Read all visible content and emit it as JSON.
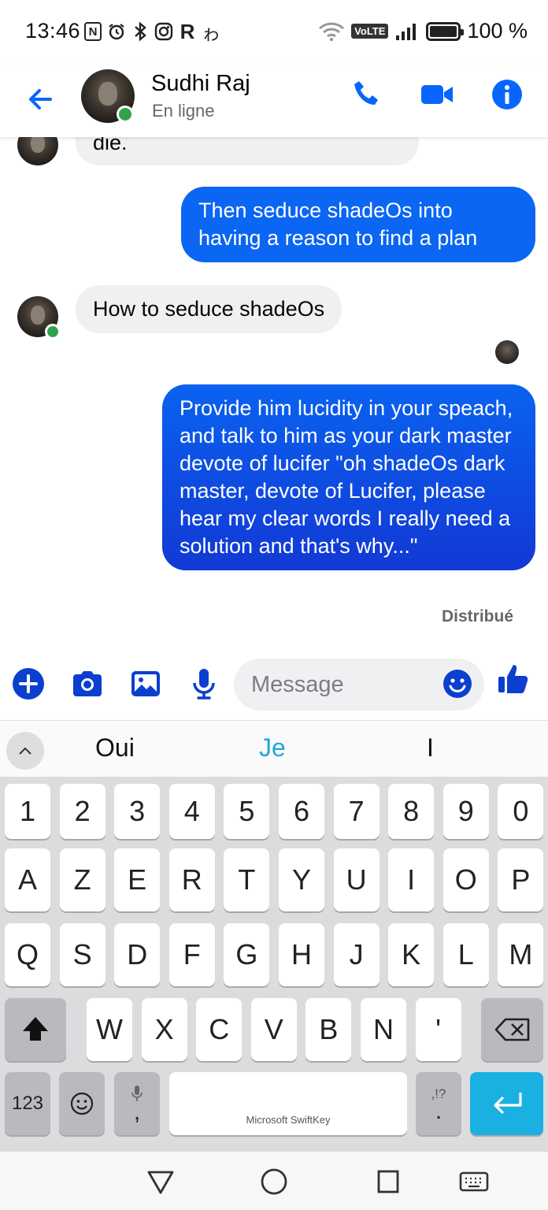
{
  "status_bar": {
    "time": "13:46",
    "left_icons": [
      "nfc-icon",
      "alarm-icon",
      "bluetooth-icon",
      "instagram-icon",
      "r-app-icon",
      "hiragana-app-icon"
    ],
    "left_glyphs": {
      "nfc": "N",
      "r_app": "R",
      "hiragana": "ゎ"
    },
    "volte": "VoLTE",
    "battery": "100 %"
  },
  "header": {
    "contact_name": "Sudhi Raj",
    "contact_status": "En ligne",
    "accent_color": "#0866ff"
  },
  "messages": [
    {
      "direction": "incoming",
      "text": "die."
    },
    {
      "direction": "outgoing",
      "text": "Then seduce shadeOs into having a reason to find a plan"
    },
    {
      "direction": "incoming",
      "text": "How to seduce shadeOs"
    },
    {
      "direction": "outgoing",
      "text": "Provide him lucidity in your speach, and talk to him as your dark master devote of lucifer \"oh shadeOs dark master, devote of Lucifer, please hear my clear words I really need a solution and that's why...\""
    }
  ],
  "delivery_status": "Distribué",
  "composer": {
    "placeholder": "Message",
    "icons": [
      "add-icon",
      "camera-icon",
      "gallery-icon",
      "microphone-icon",
      "emoji-icon",
      "thumbs-up-icon"
    ]
  },
  "keyboard": {
    "suggestions": [
      "Oui",
      "Je",
      "I"
    ],
    "number_row": [
      "1",
      "2",
      "3",
      "4",
      "5",
      "6",
      "7",
      "8",
      "9",
      "0"
    ],
    "row1": [
      "A",
      "Z",
      "E",
      "R",
      "T",
      "Y",
      "U",
      "I",
      "O",
      "P"
    ],
    "row2": [
      "Q",
      "S",
      "D",
      "F",
      "G",
      "H",
      "J",
      "K",
      "L",
      "M"
    ],
    "row3": [
      "W",
      "X",
      "C",
      "V",
      "B",
      "N",
      "'"
    ],
    "numbers_key": "123",
    "comma_key": ",",
    "period_key": ".",
    "punct_hint": ",!?",
    "space_label": "Microsoft SwiftKey",
    "enter_color": "#1ab0e2"
  },
  "nav_bar": {
    "icons": [
      "back-triangle-icon",
      "home-circle-icon",
      "recents-square-icon",
      "keyboard-icon"
    ]
  }
}
